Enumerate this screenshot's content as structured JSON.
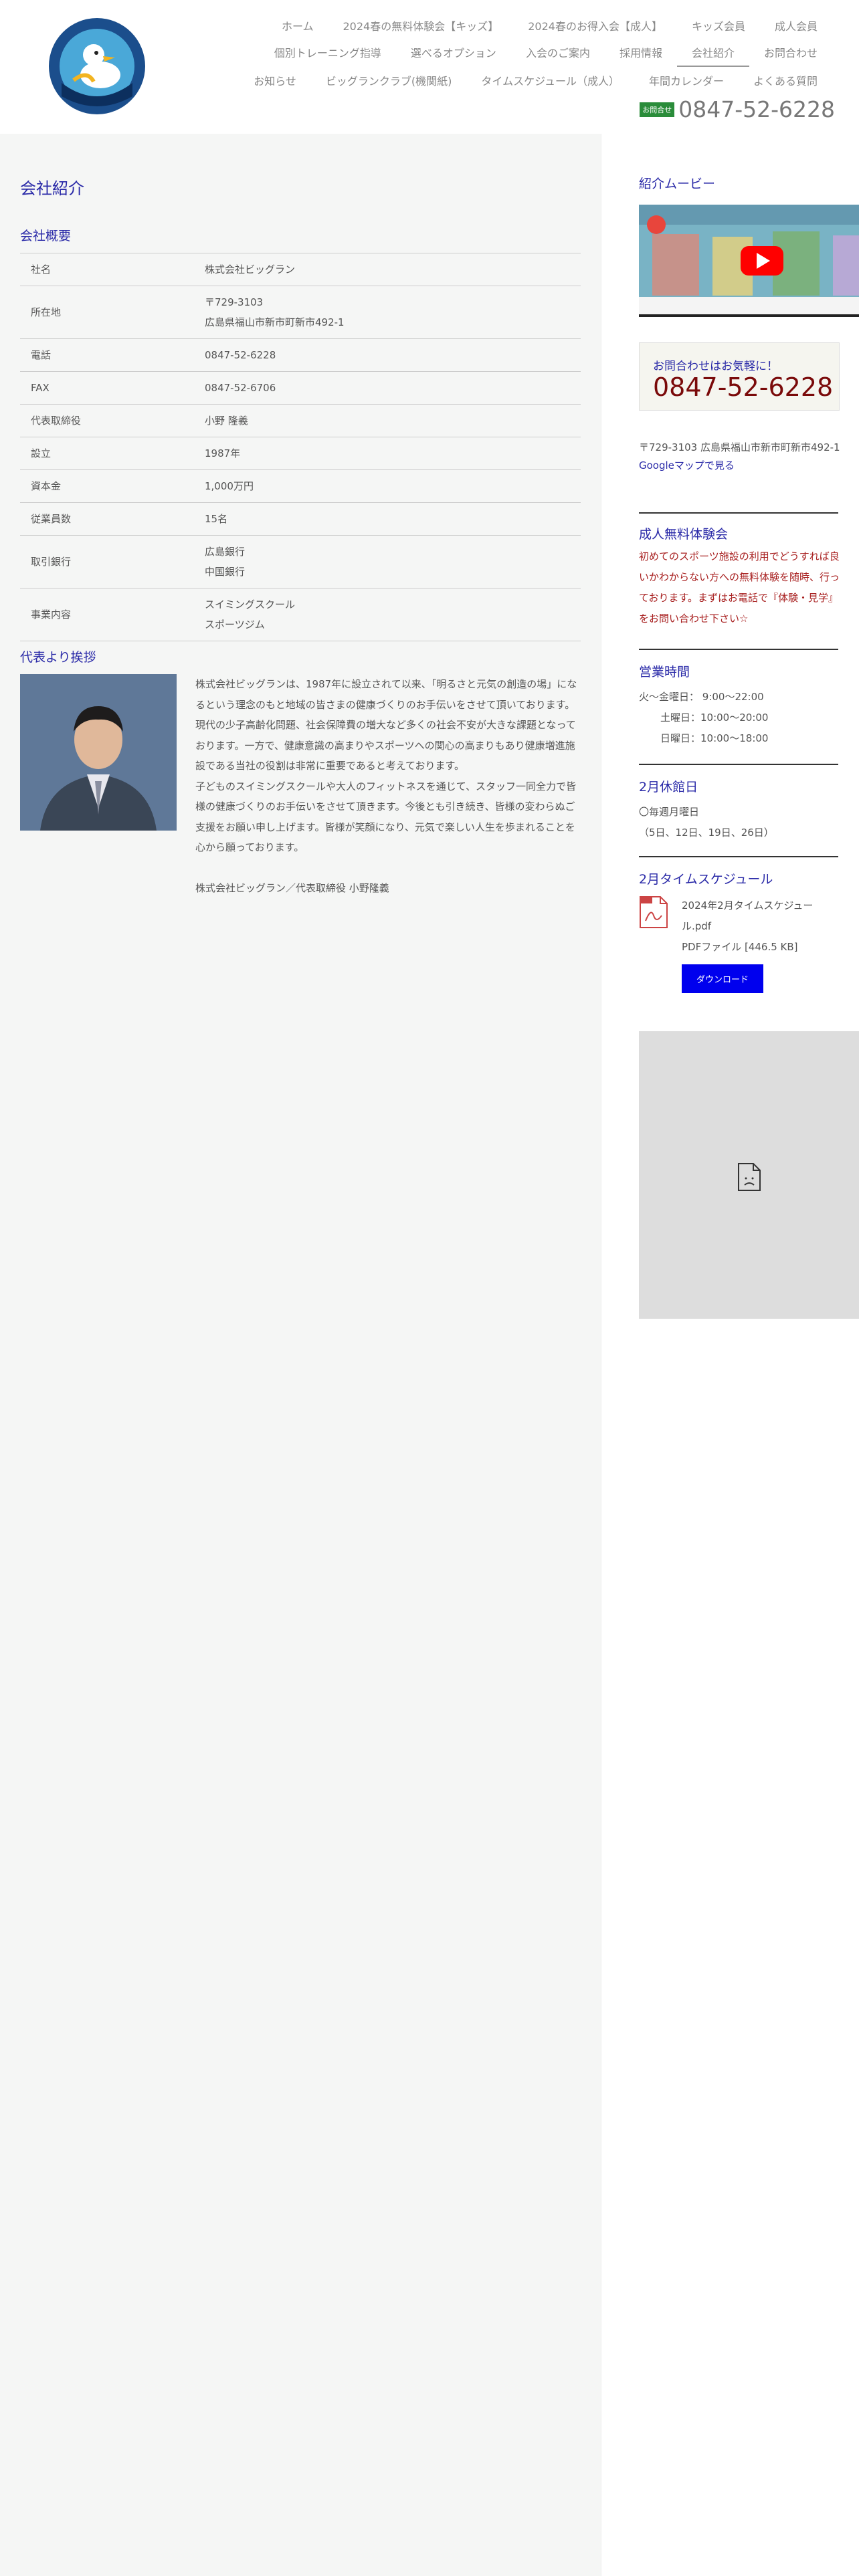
{
  "header": {
    "logo_text": "BIGLAN SWIMMING SCHOOL",
    "nav_row1": [
      "ホーム",
      "2024春の無料体験会【キッズ】",
      "2024春のお得入会【成人】",
      "キッズ会員",
      "成人会員"
    ],
    "nav_row2": [
      "個別トレーニング指導",
      "選べるオプション",
      "入会のご案内",
      "採用情報",
      "会社紹介",
      "お問合わせ"
    ],
    "nav_row3": [
      "お知らせ",
      "ビッグランクラブ(機関紙)",
      "タイムスケジュール（成人）",
      "年間カレンダー",
      "よくある質問"
    ],
    "contact_badge": "お問合せ",
    "phone": "0847-52-6228"
  },
  "main": {
    "page_title": "会社紹介",
    "outline_title": "会社概要",
    "table": [
      {
        "k": "社名",
        "v": [
          "株式会社ビッグラン"
        ]
      },
      {
        "k": "所在地",
        "v": [
          "〒729-3103",
          "広島県福山市新市町新市492-1"
        ]
      },
      {
        "k": "電話",
        "v": [
          "0847-52-6228"
        ]
      },
      {
        "k": "FAX",
        "v": [
          "0847-52-6706"
        ]
      },
      {
        "k": "代表取締役",
        "v": [
          "小野 隆義"
        ]
      },
      {
        "k": "設立",
        "v": [
          "1987年"
        ]
      },
      {
        "k": "資本金",
        "v": [
          "1,000万円"
        ]
      },
      {
        "k": "従業員数",
        "v": [
          "15名"
        ]
      },
      {
        "k": "取引銀行",
        "v": [
          "広島銀行",
          "中国銀行"
        ]
      },
      {
        "k": "事業内容",
        "v": [
          "スイミングスクール",
          "スポーツジム"
        ]
      }
    ],
    "greeting_title": "代表より挨拶",
    "greeting_p1": "株式会社ビッグランは、1987年に設立されて以来、「明るさと元気の創造の場」になるという理念のもと地域の皆さまの健康づくりのお手伝いをさせて頂いております。現代の少子高齢化問題、社会保障費の増大など多くの社会不安が大きな課題となっております。一方で、健康意識の高まりやスポーツへの関心の高まりもあり健康増進施設である当社の役割は非常に重要であると考えております。",
    "greeting_p2": "子どものスイミングスクールや大人のフィットネスを通じて、スタッフ一同全力で皆様の健康づくりのお手伝いをさせて頂きます。今後とも引き続き、皆様の変わらぬご支援をお願い申し上げます。皆様が笑顔になり、元気で楽しい人生を歩まれることを心から願っております。",
    "greeting_sign": "株式会社ビッグラン／代表取締役 小野隆義"
  },
  "sidebar": {
    "movie_title": "紹介ムービー",
    "contact_title": "お問合わせはお気軽に！",
    "contact_phone": "0847-52-6228",
    "address": "〒729-3103 広島県福山市新市町新市492-1",
    "map_link": "Googleマップで見る",
    "trial_title": "成人無料体験会",
    "trial_text": "初めてのスポーツ施設の利用でどうすれば良いかわからない方への無料体験を随時、行っております。まずはお電話で『体験・見学』をお問い合わせ下さい☆",
    "hours_title": "営業時間",
    "hours": [
      "火〜金曜日： 9:00〜22:00",
      "土曜日：10:00〜20:00",
      "日曜日：10:00〜18:00"
    ],
    "closed_title": "2月休館日",
    "closed_lines": [
      "〇毎週月曜日",
      "（5日、12日、19日、26日）"
    ],
    "schedule_title": "2月タイムスケジュール",
    "file_name": "2024年2月タイムスケジュール.pdf",
    "file_meta": "PDFファイル [446.5 KB]",
    "download_label": "ダウンロード"
  },
  "colors": {
    "accent": "#2a2aa8",
    "phone_red": "#7a0a0a",
    "trial_red": "#a82020",
    "download_blue": "#0000ee",
    "badge_green": "#2a8c3a"
  }
}
